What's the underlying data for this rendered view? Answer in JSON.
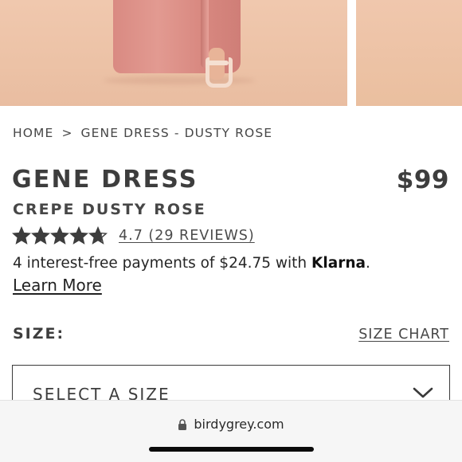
{
  "breadcrumb": {
    "home": "HOME",
    "separator": ">",
    "current": "GENE DRESS - DUSTY ROSE"
  },
  "product": {
    "title": "GENE DRESS",
    "price": "$99",
    "subtitle": "CREPE DUSTY ROSE",
    "rating_value": 4.7,
    "rating_max": 5,
    "rating_link": "4.7 (29 REVIEWS)"
  },
  "klarna": {
    "text": "4 interest-free payments of $24.75 with ",
    "brand": "Klarna",
    "suffix": ".",
    "learn_more": "Learn More"
  },
  "size": {
    "label": "SIZE:",
    "chart_link": "SIZE CHART",
    "select_placeholder": "SELECT A SIZE"
  },
  "browser": {
    "url": "birdygrey.com"
  },
  "icons": {
    "star": "star-icon",
    "lock": "lock-icon",
    "chevron": "chevron-down-icon"
  },
  "colors": {
    "text": "#3d3d3d",
    "dress": "#d98a82",
    "backdrop": "#ecc2a6"
  }
}
